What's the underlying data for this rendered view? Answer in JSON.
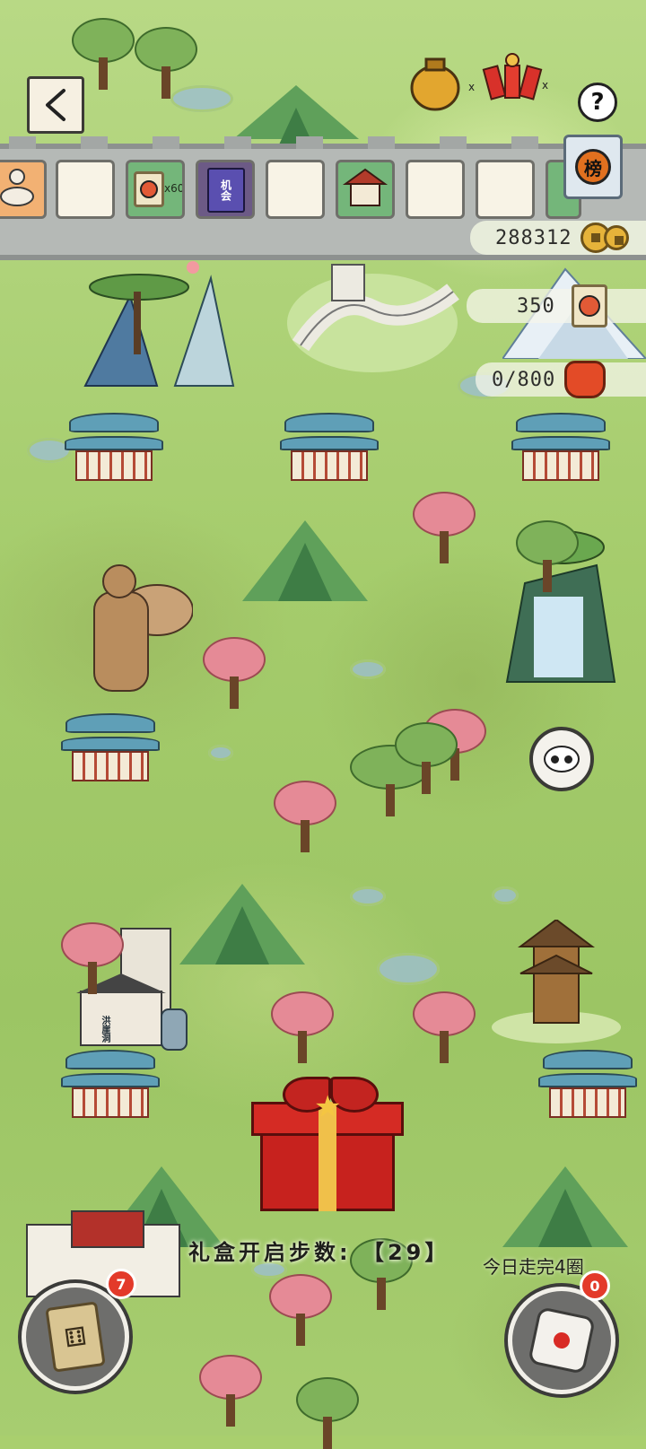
{
  "header": {
    "back_icon": "chevron-left-icon",
    "help_label": "?",
    "rank_label": "榜",
    "coins": "288312",
    "tickets": "350",
    "bag_progress": "0/800",
    "pot_multiplier": "x",
    "firecracker_multiplier": "x"
  },
  "board_tiles": [
    {
      "type": "character",
      "icon": "camel-rider-icon",
      "label": ""
    },
    {
      "type": "empty",
      "icon": "",
      "label": ""
    },
    {
      "type": "ticket",
      "icon": "ticket-scroll-icon",
      "label": "x60"
    },
    {
      "type": "chance",
      "icon": "chance-book-icon",
      "label": "机会"
    },
    {
      "type": "empty",
      "icon": "",
      "label": ""
    },
    {
      "type": "building",
      "icon": "pavilion-icon",
      "label": ""
    },
    {
      "type": "empty",
      "icon": "",
      "label": ""
    },
    {
      "type": "empty",
      "icon": "",
      "label": ""
    }
  ],
  "gift": {
    "step_text": "礼盒开启步数: 【29】",
    "laps_text": "今日走完4圈"
  },
  "controls": {
    "cards_badge": "7",
    "dice_badge": "0"
  },
  "map_labels": {
    "stone_tablet": "洪崖洞"
  },
  "colors": {
    "grass": "#a9cf6e",
    "wall": "#b5b9b6",
    "badge_red": "#e33a2a",
    "gift_red": "#c7221e"
  }
}
